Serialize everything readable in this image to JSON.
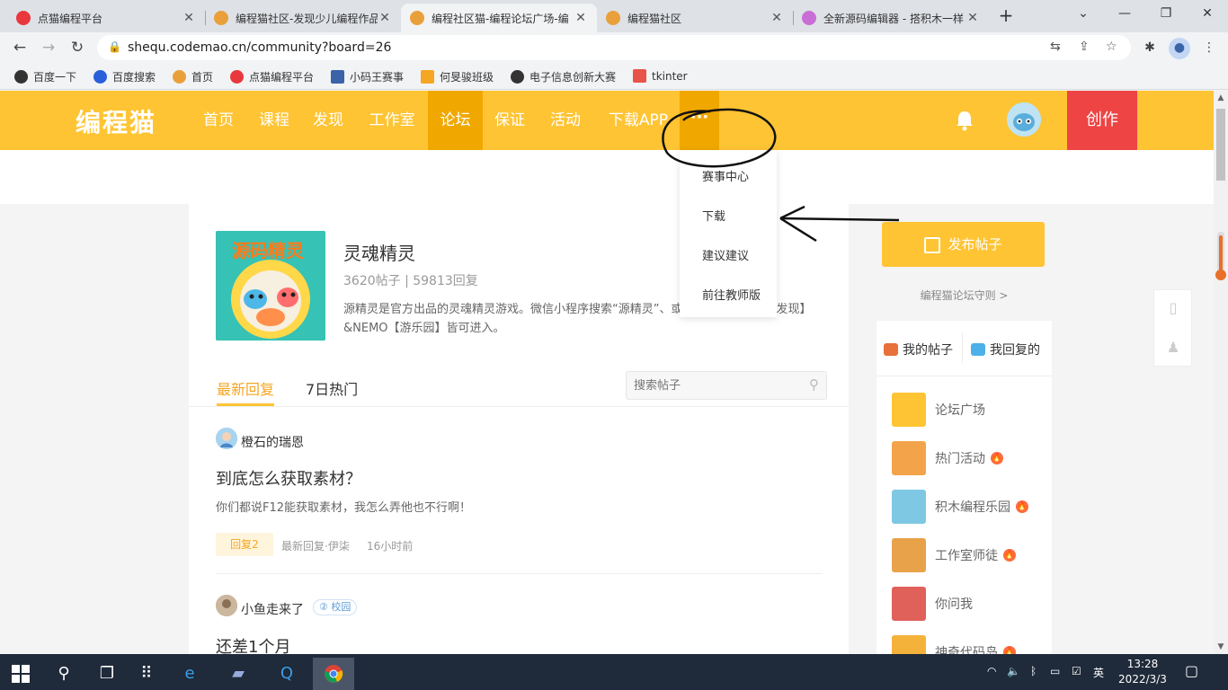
{
  "browser": {
    "tabs": [
      {
        "title": "点猫编程平台",
        "active": false
      },
      {
        "title": "编程猫社区-发现少儿编程作品",
        "active": false
      },
      {
        "title": "编程社区猫-编程论坛广场-编",
        "active": true
      },
      {
        "title": "编程猫社区",
        "active": false
      },
      {
        "title": "全新源码编辑器 - 搭积木一样",
        "active": false
      }
    ],
    "address": "shequ.codemao.cn/community?board=26",
    "bookmarks": [
      "百度一下",
      "百度搜索",
      "首页",
      "点猫编程平台",
      "小码王赛事",
      "何旻骏班级",
      "电子信息创新大赛",
      "tkinter"
    ],
    "colors": {
      "tabstrip": "#dee1e6",
      "toolbar": "#f1f3f4"
    }
  },
  "site": {
    "logo": "编程猫",
    "nav": [
      "首页",
      "课程",
      "发现",
      "工作室",
      "论坛",
      "保证",
      "活动",
      "下载APP"
    ],
    "nav_active": "论坛",
    "more_label": "···",
    "create_label": "创作",
    "accent": "#fec433",
    "create_color": "#ee4444"
  },
  "dropdown": {
    "items": [
      "赛事中心",
      "下载",
      "建议建议",
      "前往教师版"
    ]
  },
  "board": {
    "cover_text": "源码精灵",
    "name": "灵魂精灵",
    "stats": "3620帖子 | 59813回复",
    "description": "源精灵是官方出品的灵魂精灵游戏。微信小程序搜索“源精灵”、或通过编程猫社区【发现】&NEMO【游乐园】皆可进入。",
    "tabs": [
      "最新回复",
      "7日热门"
    ],
    "search_placeholder": "搜索帖子"
  },
  "posts": [
    {
      "author": "橙石的瑞恩",
      "title": "到底怎么获取素材？",
      "body": "你们都说F12能获取素材，我怎么弄他也不行啊！",
      "reply_badge": "回复2",
      "latest_reply": "最新回复·伊柒",
      "time": "16小时前"
    },
    {
      "author": "小鱼走来了",
      "badge": "校园",
      "title": "还差1个月"
    }
  ],
  "sidebar": {
    "publish_label": "发布帖子",
    "rules_link": "编程猫论坛守则 >",
    "my_tabs": [
      "我的帖子",
      "我回复的"
    ],
    "forums": [
      {
        "name": "论坛广场",
        "hot": false
      },
      {
        "name": "热门活动",
        "hot": true
      },
      {
        "name": "积木编程乐园",
        "hot": true
      },
      {
        "name": "工作室师徒",
        "hot": true
      },
      {
        "name": "你问我",
        "hot": false
      },
      {
        "name": "神奇代码岛",
        "hot": true
      }
    ]
  },
  "taskbar": {
    "time": "13:28",
    "date": "2022/3/3",
    "ime": "英"
  }
}
